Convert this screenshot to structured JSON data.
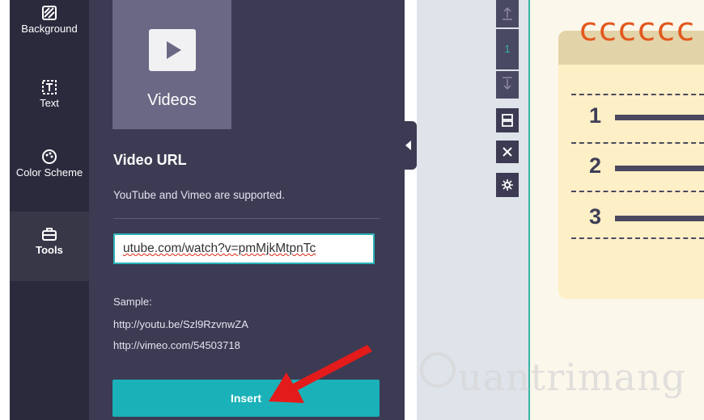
{
  "sidebar": {
    "items": [
      {
        "label": "Background",
        "icon": "background-pattern-icon"
      },
      {
        "label": "Text",
        "icon": "text-box-icon"
      },
      {
        "label": "Color Scheme",
        "icon": "palette-icon"
      },
      {
        "label": "Tools",
        "icon": "toolbox-icon"
      }
    ]
  },
  "panel": {
    "tile_label": "Videos",
    "video_url_title": "Video URL",
    "subtitle": "YouTube and Vimeo are supported.",
    "url_value": "utube.com/watch?v=pmMjkMtpnTc",
    "sample_label": "Sample:",
    "sample_youtube": "http://youtu.be/Szl9RzvnwZA",
    "sample_vimeo": "http://vimeo.com/54503718",
    "insert_label": "Insert"
  },
  "toolbar": {
    "page_number": "1"
  },
  "slide": {
    "numbers": [
      "1",
      "2",
      "3"
    ]
  },
  "watermark": "uantrimang",
  "colors": {
    "accent": "#1ab2b8",
    "sidebar": "#2b2a3d",
    "panel": "#3c3b53",
    "arrow": "#e31b1b"
  }
}
